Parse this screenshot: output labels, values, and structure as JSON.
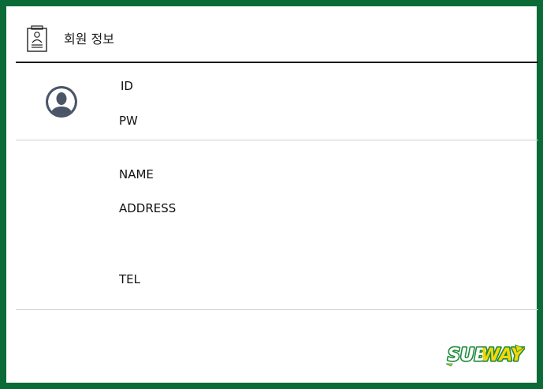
{
  "header": {
    "title": "회원 정보",
    "icon": "id-card-icon"
  },
  "account": {
    "avatar_icon": "user-avatar-icon",
    "id_label": "ID",
    "pw_label": "PW"
  },
  "profile": {
    "name_label": "NAME",
    "address_label": "ADDRESS",
    "tel_label": "TEL"
  },
  "footer": {
    "logo_text": "SUBWAY"
  },
  "colors": {
    "frame": "#0b6b37",
    "logo_green": "#1c8a3a",
    "logo_yellow": "#f5d60a",
    "avatar": "#4a5568"
  }
}
